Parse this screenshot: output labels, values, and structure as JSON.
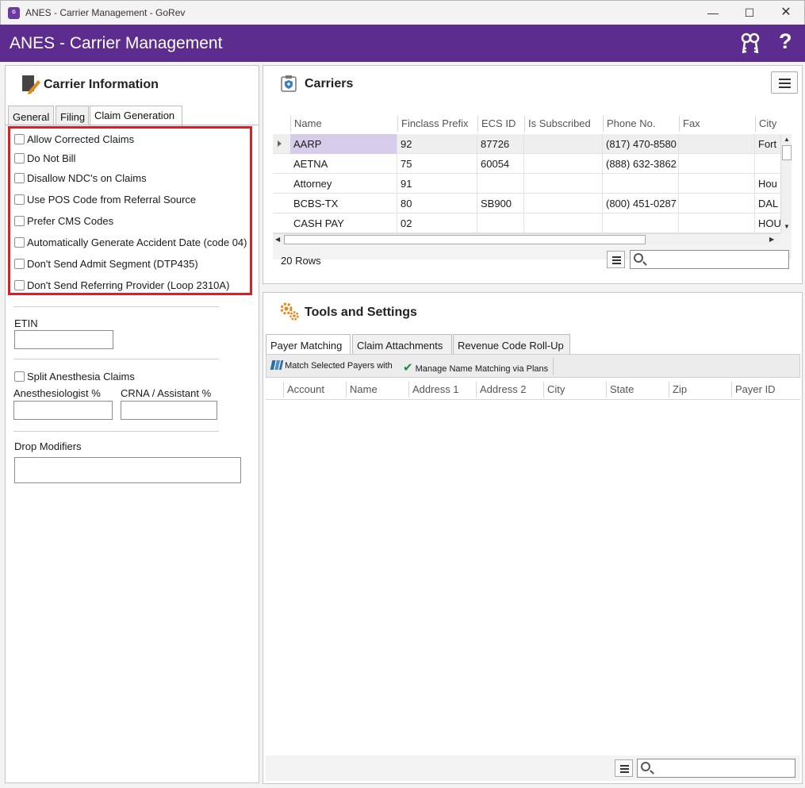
{
  "window": {
    "title": "ANES - Carrier Management - GoRev",
    "app_icon_text": "GoRev"
  },
  "header": {
    "title": "ANES - Carrier Management"
  },
  "carrier_info": {
    "title": "Carrier Information",
    "tabs": [
      "General",
      "Filing",
      "Claim Generation"
    ],
    "active_tab": "Claim Generation",
    "checkboxes": [
      "Allow Corrected Claims",
      "Do Not Bill",
      "Disallow NDC's on Claims",
      "Use POS Code from Referral Source",
      "Prefer CMS Codes",
      "Automatically Generate Accident Date (code 04)",
      "Don't Send Admit Segment (DTP435)",
      "Don't Send Referring Provider (Loop 2310A)"
    ],
    "etin_label": "ETIN",
    "etin_value": "",
    "split_anesthesia_label": "Split Anesthesia Claims",
    "anesthesiologist_label": "Anesthesiologist %",
    "anesthesiologist_value": "",
    "crna_label": "CRNA / Assistant %",
    "crna_value": "",
    "drop_modifiers_label": "Drop Modifiers",
    "drop_modifiers_value": ""
  },
  "carriers": {
    "title": "Carriers",
    "columns": [
      "Name",
      "Finclass Prefix",
      "ECS ID",
      "Is Subscribed",
      "Phone No.",
      "Fax",
      "City"
    ],
    "rows": [
      [
        "AARP",
        "92",
        "87726",
        "",
        "(817) 470-8580",
        "",
        "Fort"
      ],
      [
        "AETNA",
        "75",
        "60054",
        "",
        "(888) 632-3862",
        "",
        ""
      ],
      [
        "Attorney",
        "91",
        "",
        "",
        "",
        "",
        "Hou"
      ],
      [
        "BCBS-TX",
        "80",
        "SB900",
        "",
        "(800) 451-0287",
        "",
        "DAL"
      ],
      [
        "CASH PAY",
        "02",
        "",
        "",
        "",
        "",
        "HOU"
      ]
    ],
    "row_count": "20 Rows",
    "search_value": ""
  },
  "tools": {
    "title": "Tools and Settings",
    "tabs": [
      "Payer Matching",
      "Claim Attachments",
      "Revenue Code Roll-Up"
    ],
    "active_tab": "Payer Matching",
    "toolbar": {
      "match_label": "Match Selected Payers with",
      "manage_label": "Manage Name Matching via Plans"
    },
    "columns": [
      "Account",
      "Name",
      "Address 1",
      "Address 2",
      "City",
      "State",
      "Zip",
      "Payer ID"
    ],
    "search_value": ""
  },
  "colors": {
    "header_purple": "#5c2d8e",
    "highlight_red": "#e01d25",
    "selected_cell": "#d7cdea"
  }
}
